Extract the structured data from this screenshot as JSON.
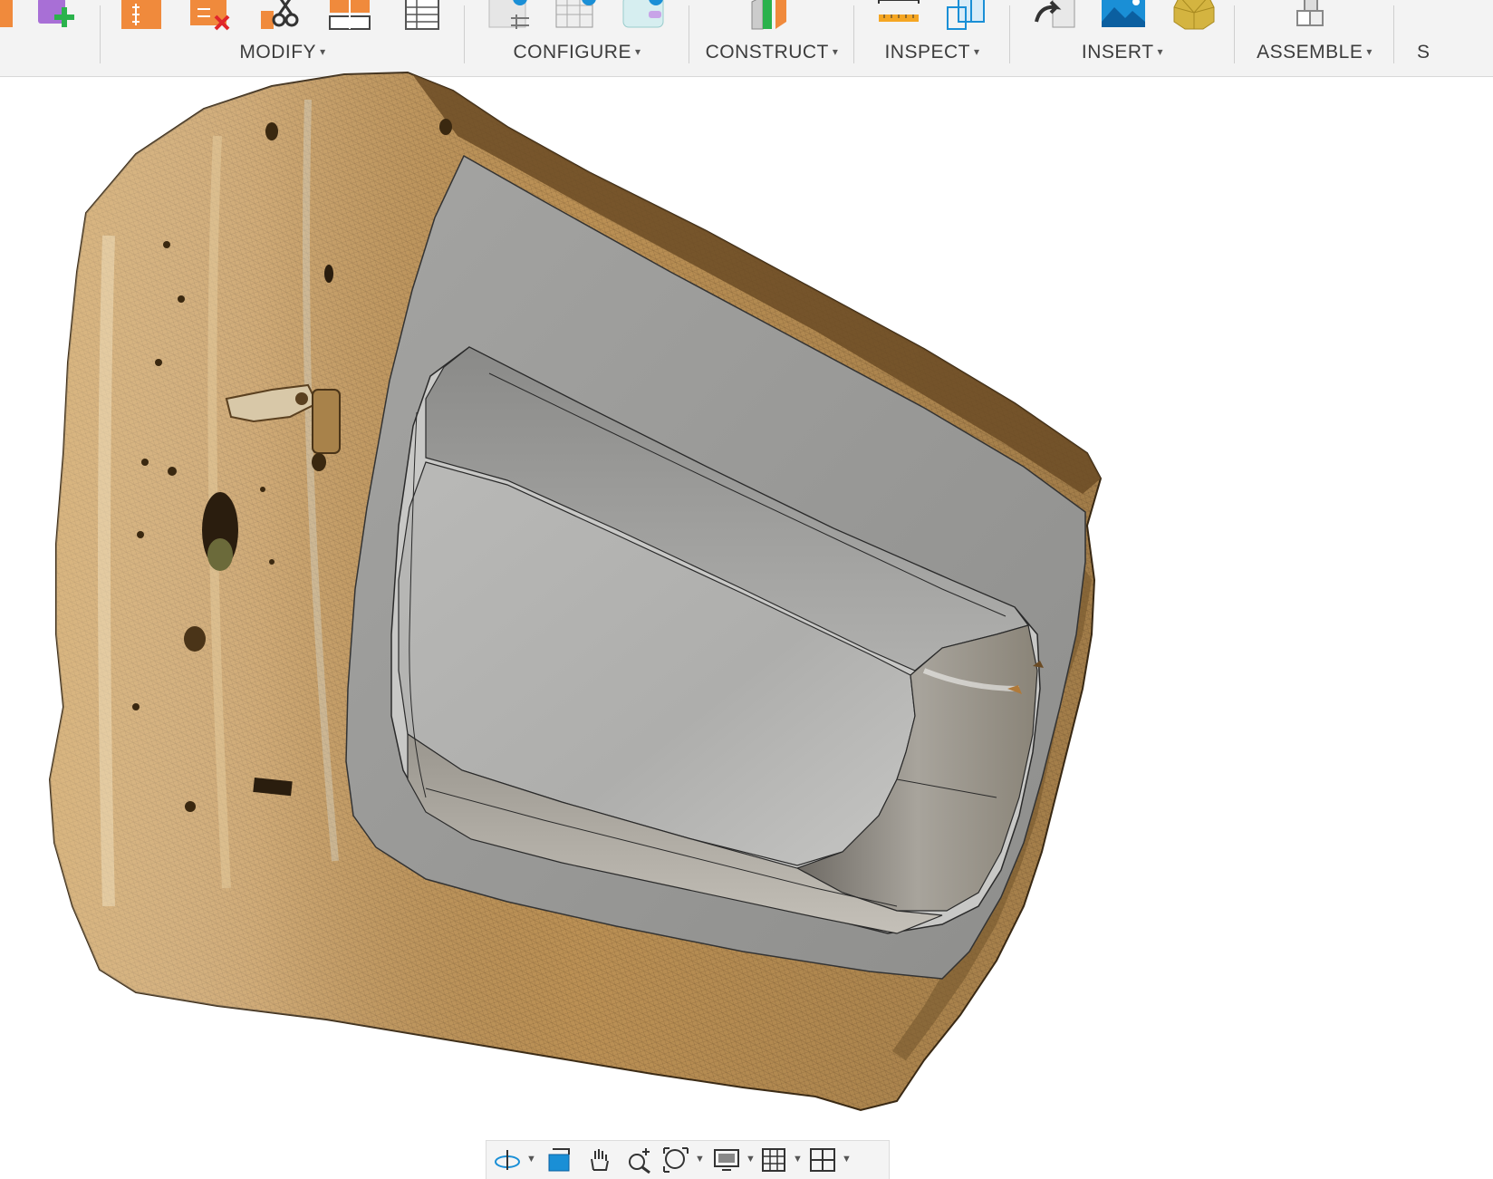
{
  "toolbar": {
    "groups": [
      {
        "label": "MODIFY"
      },
      {
        "label": "CONFIGURE"
      },
      {
        "label": "CONSTRUCT"
      },
      {
        "label": "INSPECT"
      },
      {
        "label": "INSERT"
      },
      {
        "label": "ASSEMBLE"
      },
      {
        "label": "S"
      }
    ],
    "caret": "▾"
  },
  "icons": {
    "modify": [
      "press-pull-icon",
      "delete-icon",
      "split-icon",
      "align-icon",
      "table-icon"
    ],
    "configure": [
      "configure-rule-icon",
      "configure-table-icon",
      "configure-theme-icon"
    ],
    "construct": [
      "midplane-icon"
    ],
    "inspect": [
      "measure-icon",
      "section-analysis-icon"
    ],
    "insert": [
      "insert-derive-icon",
      "insert-canvas-icon",
      "insert-mesh-icon"
    ],
    "assemble": [
      "new-component-icon"
    ]
  },
  "navbar": {
    "items": [
      "orbit-icon",
      "look-at-icon",
      "pan-icon",
      "zoom-icon",
      "fit-icon",
      "display-settings-icon",
      "grid-icon",
      "viewports-icon"
    ]
  },
  "colors": {
    "mesh_tan": "#c69a5c",
    "mesh_dark": "#7a5a30",
    "surface_gray": "#9a9a98",
    "inner_gray": "#b5b5b3",
    "accent_orange": "#f08a3c",
    "accent_blue": "#1a8fd6"
  }
}
